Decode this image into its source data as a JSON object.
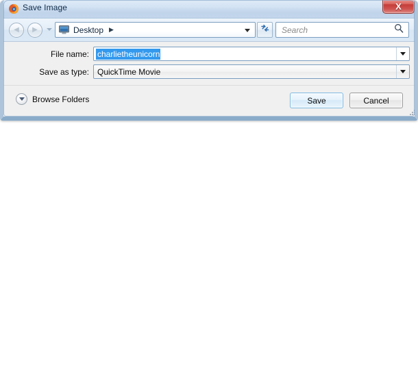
{
  "window": {
    "title": "Save Image",
    "title_icon": "firefox-icon",
    "close_label": "X",
    "bg_color": "#f0f0f0",
    "titlebar_color": "#cbdcf0",
    "close_color": "#c43c39"
  },
  "nav": {
    "back_icon": "back-arrow-icon",
    "back_glyph": "◀",
    "forward_icon": "forward-arrow-icon",
    "forward_glyph": "▶",
    "history_dropdown_icon": "chevron-down-icon",
    "address": {
      "icon": "desktop-icon",
      "label": "Desktop",
      "separator": "▶",
      "dropdown_icon": "chevron-down-icon"
    },
    "refresh_icon": "refresh-icon",
    "search": {
      "placeholder": "Search",
      "value": "",
      "icon": "search-icon"
    }
  },
  "form": {
    "filename": {
      "label": "File name:",
      "value": "charlietheunicorn",
      "selected": true,
      "selection_color": "#3399ee",
      "dropdown_icon": "chevron-down-icon"
    },
    "savetype": {
      "label": "Save as type:",
      "value": "QuickTime Movie",
      "dropdown_icon": "chevron-down-icon"
    }
  },
  "footer": {
    "browse": {
      "label": "Browse Folders",
      "icon": "chevron-down-circle-icon"
    },
    "save_label": "Save",
    "cancel_label": "Cancel",
    "save_focus_color": "#7bb7e0",
    "resize_grip_icon": "resize-grip-icon"
  }
}
